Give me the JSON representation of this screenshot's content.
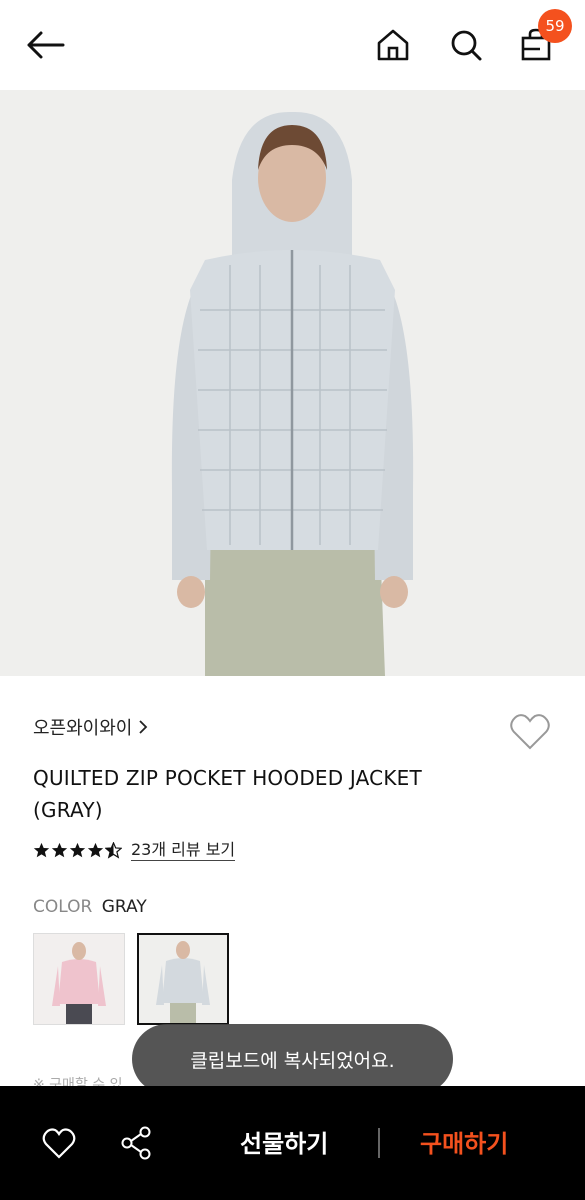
{
  "header": {
    "cart_count": "59"
  },
  "product": {
    "brand": "오픈와이와이",
    "title_line1": "QUILTED ZIP POCKET HOODED JACKET",
    "title_line2": "(GRAY)",
    "rating": 4.5,
    "review_link": "23개 리뷰 보기",
    "color_label": "COLOR",
    "color_value": "GRAY",
    "note": "※ 구매할 수 있"
  },
  "toast": {
    "message": "클립보드에 복사되었어요."
  },
  "bottom_bar": {
    "gift_label": "선물하기",
    "buy_label": "구매하기"
  },
  "colors": {
    "accent": "#f4511e",
    "bottom_bar_bg": "#000000",
    "toast_bg": "#484848"
  },
  "icons": [
    "back-arrow-icon",
    "home-icon",
    "search-icon",
    "shopping-bag-icon",
    "heart-icon",
    "share-icon",
    "star-icon",
    "chevron-right-icon"
  ]
}
